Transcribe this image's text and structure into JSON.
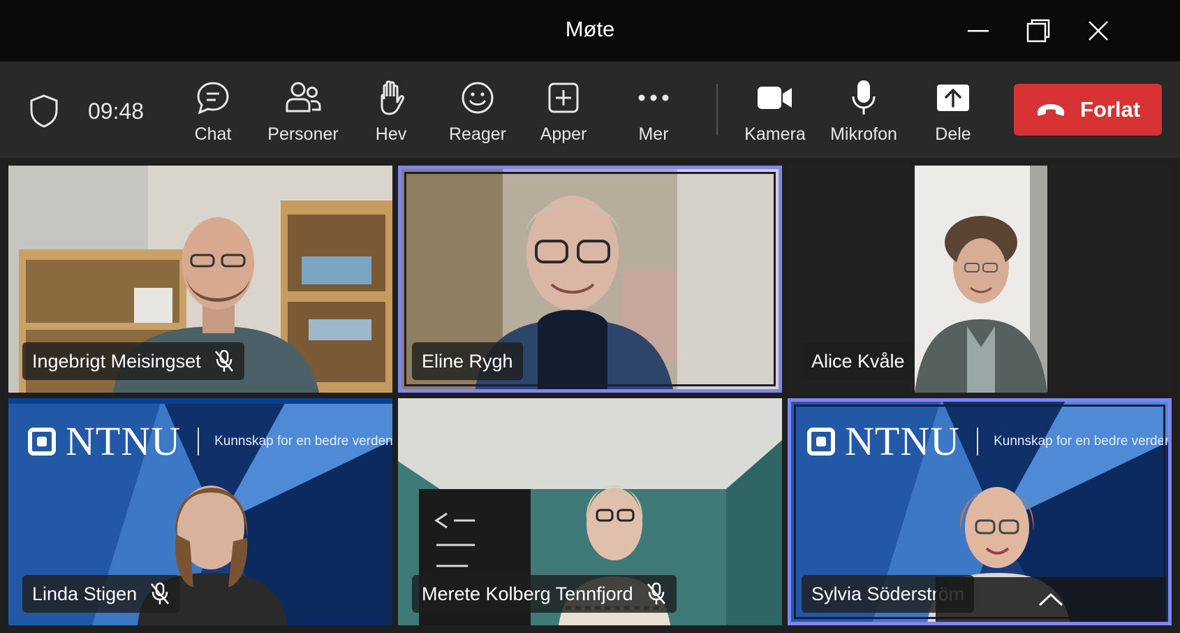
{
  "window": {
    "title": "Møte"
  },
  "toolbar": {
    "time": "09:48",
    "chat_label": "Chat",
    "people_label": "Personer",
    "raise_label": "Hev",
    "react_label": "Reager",
    "apps_label": "Apper",
    "more_label": "Mer",
    "camera_label": "Kamera",
    "mic_label": "Mikrofon",
    "share_label": "Dele",
    "leave_label": "Forlat"
  },
  "participants": [
    {
      "name": "Ingebrigt Meisingset",
      "muted": true,
      "speaking": false
    },
    {
      "name": "Eline Rygh",
      "muted": false,
      "speaking": true
    },
    {
      "name": "Alice Kvåle",
      "muted": false,
      "speaking": false
    },
    {
      "name": "Linda Stigen",
      "muted": true,
      "speaking": false
    },
    {
      "name": "Merete Kolberg Tennfjord",
      "muted": true,
      "speaking": false
    },
    {
      "name": "Sylvia Söderström",
      "muted": false,
      "speaking": true
    }
  ],
  "background": {
    "brand": "NTNU",
    "tagline": "Kunnskap for en bedre verden"
  },
  "colors": {
    "title_bar": "#0a0a0a",
    "toolbar": "#292929",
    "leave_button": "#d73335",
    "speaking_ring": "#7f85f5"
  },
  "icons": {
    "security": "shield-icon",
    "chat": "chat-bubble-icon",
    "people": "people-icon",
    "raise": "raised-hand-icon",
    "react": "smiley-icon",
    "apps": "plus-square-icon",
    "more": "ellipsis-icon",
    "camera": "video-camera-icon",
    "mic": "microphone-icon",
    "share": "share-upload-icon",
    "leave": "hang-up-phone-icon",
    "muted": "mic-off-icon"
  }
}
